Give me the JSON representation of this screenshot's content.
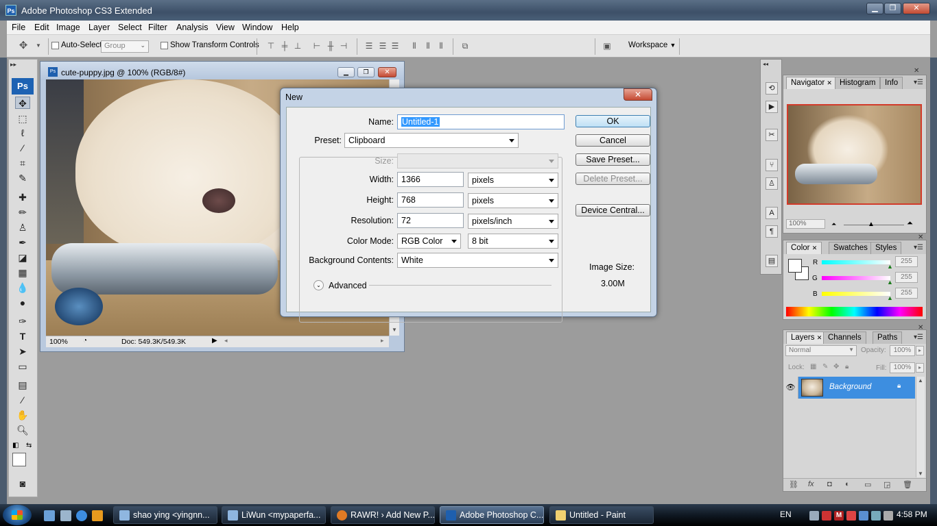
{
  "app": {
    "title": "Adobe Photoshop CS3 Extended",
    "logo": "Ps"
  },
  "window_controls": {
    "minimize": "▁",
    "maximize": "❐",
    "close": "✕"
  },
  "menu": [
    "File",
    "Edit",
    "Image",
    "Layer",
    "Select",
    "Filter",
    "Analysis",
    "View",
    "Window",
    "Help"
  ],
  "options_bar": {
    "auto_select_label": "Auto-Select:",
    "auto_select_value": "Group",
    "show_transform_label": "Show Transform Controls",
    "workspace_label": "Workspace"
  },
  "toolbox": {
    "badge": "Ps"
  },
  "document": {
    "title": "cute-puppy.jpg @ 100% (RGB/8#)",
    "zoom": "100%",
    "doc_info": "Doc: 549.3K/549.3K"
  },
  "dialog": {
    "title": "New",
    "name_label": "Name:",
    "name_value": "Untitled-1",
    "preset_label": "Preset:",
    "preset_value": "Clipboard",
    "size_label": "Size:",
    "size_value": "",
    "width_label": "Width:",
    "width_value": "1366",
    "width_unit": "pixels",
    "height_label": "Height:",
    "height_value": "768",
    "height_unit": "pixels",
    "resolution_label": "Resolution:",
    "resolution_value": "72",
    "resolution_unit": "pixels/inch",
    "color_mode_label": "Color Mode:",
    "color_mode_value": "RGB Color",
    "bit_depth_value": "8 bit",
    "background_label": "Background Contents:",
    "background_value": "White",
    "advanced_label": "Advanced",
    "buttons": {
      "ok": "OK",
      "cancel": "Cancel",
      "save_preset": "Save Preset...",
      "delete_preset": "Delete Preset...",
      "device_central": "Device Central..."
    },
    "image_size_label": "Image Size:",
    "image_size_value": "3.00M"
  },
  "navigator_panel": {
    "tabs": [
      "Navigator",
      "Histogram",
      "Info"
    ],
    "zoom": "100%"
  },
  "color_panel": {
    "tabs": [
      "Color",
      "Swatches",
      "Styles"
    ],
    "channels": [
      {
        "label": "R",
        "value": "255"
      },
      {
        "label": "G",
        "value": "255"
      },
      {
        "label": "B",
        "value": "255"
      }
    ]
  },
  "layers_panel": {
    "tabs": [
      "Layers",
      "Channels",
      "Paths"
    ],
    "blend_mode": "Normal",
    "opacity_label": "Opacity:",
    "opacity_value": "100%",
    "lock_label": "Lock:",
    "fill_label": "Fill:",
    "fill_value": "100%",
    "layer_name": "Background"
  },
  "taskbar": {
    "items": [
      {
        "label": "shao ying <yingnn...",
        "active": false
      },
      {
        "label": "LiWun <mypaperfa...",
        "active": false
      },
      {
        "label": "RAWR! › Add New P...",
        "active": false
      },
      {
        "label": "Adobe Photoshop C...",
        "active": true
      },
      {
        "label": "Untitled - Paint",
        "active": false
      }
    ],
    "language": "EN",
    "time": "4:58 PM"
  },
  "colors": {
    "selection_blue": "#3399ff",
    "layer_highlight": "#3d8ee0",
    "dialog_frame": "#c4d3e6"
  }
}
